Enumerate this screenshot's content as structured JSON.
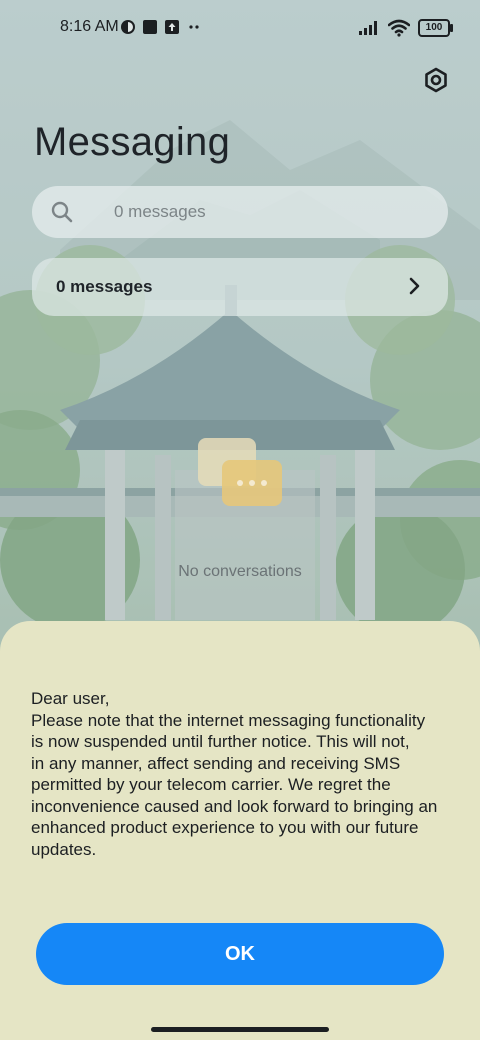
{
  "status_bar": {
    "time": "8:16 AM",
    "left_icons": [
      "vpn-icon",
      "square-notification-icon",
      "upload-notification-icon",
      "more-notifications-icon"
    ],
    "right_icons": [
      "signal-icon",
      "wifi-icon"
    ],
    "battery_level": "100"
  },
  "header": {
    "title": "Messaging",
    "settings_icon": "settings-icon"
  },
  "search": {
    "placeholder": "0 messages"
  },
  "summary": {
    "label": "0 messages"
  },
  "empty_state": {
    "text": "No conversations"
  },
  "dialog": {
    "lines": [
      "Dear user,",
      "Please note that the internet messaging functionality",
      "is now suspended until further notice. This will not,",
      "in any manner, affect sending and receiving SMS",
      "permitted by your telecom carrier. We regret the",
      "inconvenience caused and look forward to bringing an",
      "enhanced product experience to you with our future",
      "updates."
    ],
    "ok_label": "OK"
  },
  "colors": {
    "sheet_bg": "#e5e5c5",
    "accent": "#1587f7"
  }
}
